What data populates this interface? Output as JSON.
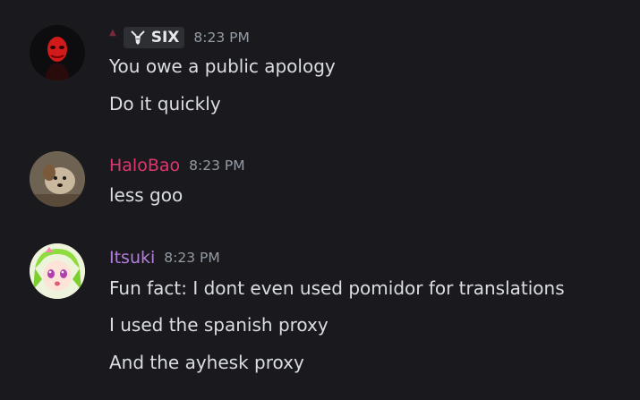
{
  "messages": [
    {
      "username": "",
      "tag": "SIX",
      "timestamp": "8:23 PM",
      "color": "#dbdee1",
      "lines": [
        "You owe a public apology",
        "Do it quickly"
      ]
    },
    {
      "username": "HaloBao",
      "timestamp": "8:23 PM",
      "color": "#e0356e",
      "lines": [
        "less goo"
      ]
    },
    {
      "username": "Itsuki",
      "timestamp": "8:23 PM",
      "color": "#b57edc",
      "lines": [
        "Fun fact: I dont even used pomidor for translations",
        "I used the spanish proxy",
        "And the ayhesk proxy"
      ]
    }
  ],
  "icons": {
    "tag_icon": "goat-head-icon",
    "avatar_1": "red-mask-avatar",
    "avatar_2": "dog-avatar",
    "avatar_3": "anime-girl-avatar"
  }
}
